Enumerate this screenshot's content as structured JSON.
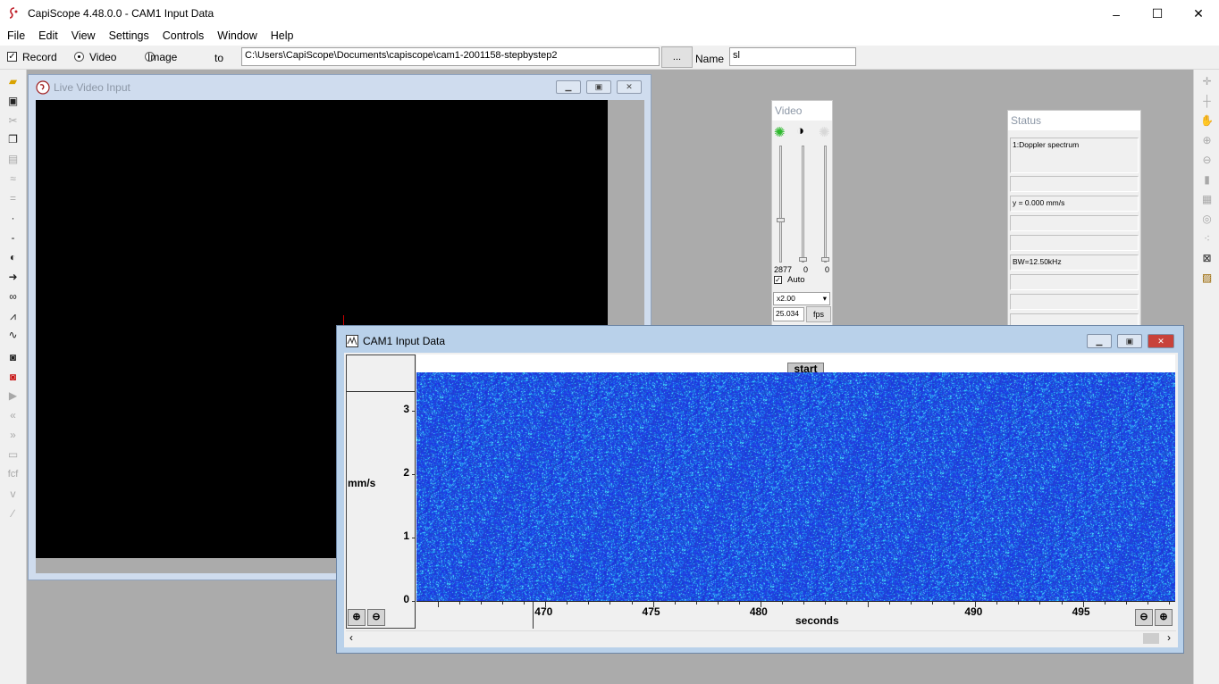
{
  "window": {
    "title": "CapiScope 4.48.0.0 - CAM1 Input Data",
    "controls": [
      "–",
      "☐",
      "✕"
    ]
  },
  "menu": [
    "File",
    "Edit",
    "View",
    "Settings",
    "Controls",
    "Window",
    "Help"
  ],
  "recordbar": {
    "record_label": "Record",
    "record_checked": true,
    "video_label": "Video",
    "image_label": "Image",
    "to_label": "to",
    "path_value": "C:\\Users\\CapiScope\\Documents\\capiscope\\cam1-2001158-stepbystep2",
    "browse_label": "...",
    "name_label": "Name",
    "name_value": "sl"
  },
  "live_window": {
    "title": "Live Video Input"
  },
  "video_panel": {
    "title": "Video",
    "values": [
      "2877",
      "0",
      "0"
    ],
    "auto_label": "Auto",
    "auto_checked": true,
    "zoom_value": "x2.00",
    "fps_value": "25.034",
    "fps_label": "fps",
    "slider_levels": [
      0.35,
      0.0,
      0.0
    ]
  },
  "status_panel": {
    "title": "Status",
    "lines": [
      "1:Doppler spectrum",
      "",
      "y = 0.000 mm/s",
      "",
      "",
      "BW=12.50kHz",
      "",
      "",
      ""
    ]
  },
  "cam_window": {
    "title": "CAM1 Input Data",
    "marker_label": "start"
  },
  "chart_data": {
    "type": "heatmap",
    "title": "",
    "ylabel": "mm/s",
    "xlabel": "seconds",
    "y_ticks": [
      "3",
      "2",
      "1",
      "0"
    ],
    "x_ticks": [
      "470",
      "475",
      "480",
      "490",
      "495"
    ],
    "colors": {
      "low": "#1a2fd4",
      "high": "#3fc4ff",
      "base": "#1f3cdc"
    }
  },
  "icons": {
    "left_toolbar": [
      "open-folder-icon",
      "save-icon",
      "cut-icon",
      "copy-icon",
      "paste-icon",
      "wave-icon",
      "equals-icon",
      "dot-icon",
      "minus-icon",
      "left-marker-icon",
      "right-marker-icon",
      "glasses-icon",
      "spectrum-icon",
      "waveform-icon",
      "camera-icon",
      "red-camera-icon",
      "play-icon",
      "rewind-icon",
      "fast-forward-icon",
      "loop-icon",
      "fcf-icon",
      "v-icon",
      "line-icon"
    ],
    "right_toolbar": [
      "crosshair-icon",
      "cursor-icon",
      "hand-icon",
      "zoom-in-icon",
      "zoom-out-icon",
      "clipboard-icon",
      "grid-icon",
      "target-icon",
      "dotted-icon",
      "lock-icon",
      "image-icon"
    ]
  }
}
